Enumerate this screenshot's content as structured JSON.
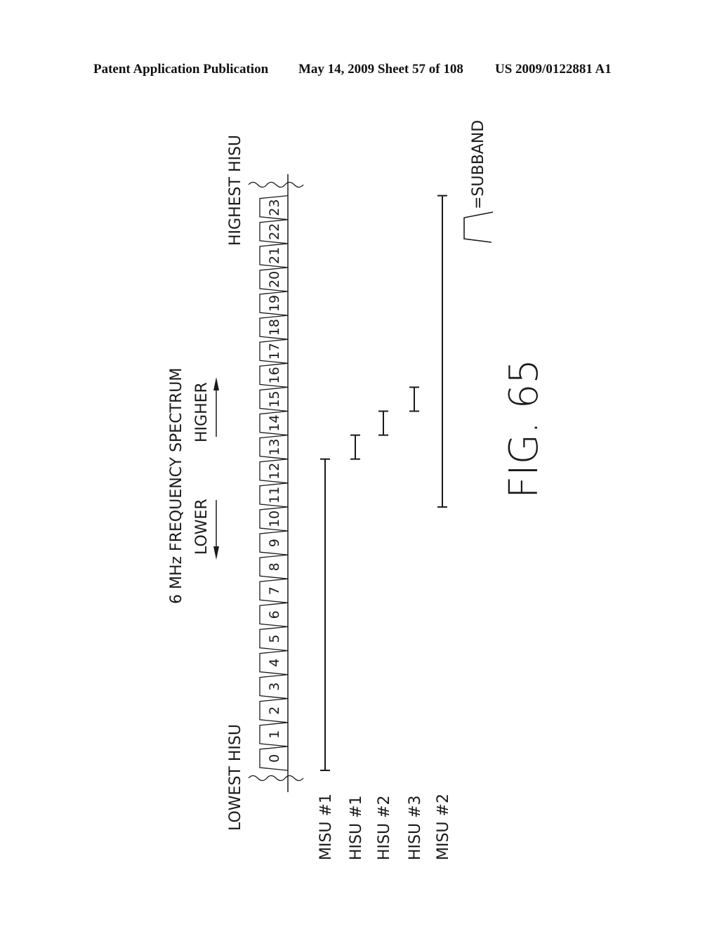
{
  "header": {
    "publication": "Patent Application Publication",
    "date_sheet": "May 14, 2009  Sheet 57 of 108",
    "patent_number": "US 2009/0122881 A1"
  },
  "figure": {
    "label": "FIG. 65",
    "title": "6 MHz FREQUENCY SPECTRUM",
    "direction_lower": "LOWER",
    "direction_higher": "HIGHER",
    "lowest_label": "LOWEST HISU",
    "highest_label": "HIGHEST HISU",
    "legend_text": "=SUBBAND",
    "subbands": [
      "0",
      "1",
      "2",
      "3",
      "4",
      "5",
      "6",
      "7",
      "8",
      "9",
      "10",
      "11",
      "12",
      "13",
      "14",
      "15",
      "16",
      "17",
      "18",
      "19",
      "20",
      "21",
      "22",
      "23"
    ],
    "allocations": [
      {
        "label": "MISU #1",
        "first_subband": 0,
        "last_subband": 12
      },
      {
        "label": "HISU #1",
        "first_subband": 13,
        "last_subband": 13
      },
      {
        "label": "HISU #2",
        "first_subband": 14,
        "last_subband": 14
      },
      {
        "label": "HISU #3",
        "first_subband": 15,
        "last_subband": 15
      },
      {
        "label": "MISU #2",
        "first_subband": 11,
        "last_subband": 23
      }
    ]
  }
}
